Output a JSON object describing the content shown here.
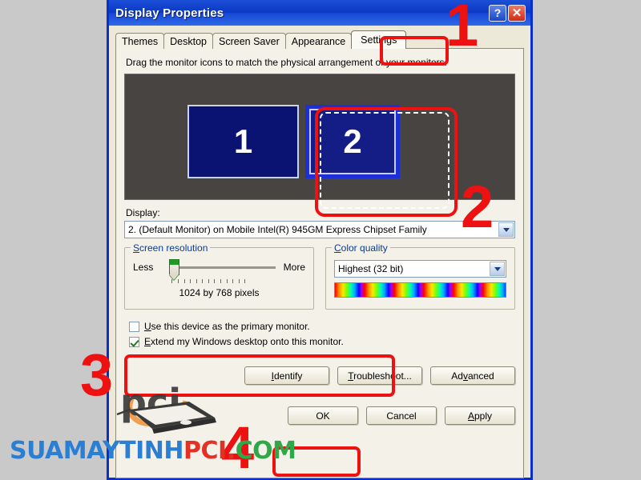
{
  "window": {
    "title": "Display Properties",
    "help_button": "?",
    "close_button": "✕"
  },
  "tabs": [
    {
      "label": "Themes",
      "active": false
    },
    {
      "label": "Desktop",
      "active": false
    },
    {
      "label": "Screen Saver",
      "active": false
    },
    {
      "label": "Appearance",
      "active": false
    },
    {
      "label": "Settings",
      "active": true
    }
  ],
  "settings": {
    "hint": "Drag the monitor icons to match the physical arrangement of your monitors.",
    "monitors": [
      {
        "number": "1",
        "selected": false
      },
      {
        "number": "2",
        "selected": true
      }
    ],
    "display_label": "Display:",
    "display_value": "2. (Default Monitor) on Mobile Intel(R) 945GM Express Chipset Family",
    "screen_resolution": {
      "legend": "Screen resolution",
      "less_label": "Less",
      "more_label": "More",
      "value_text": "1024 by 768 pixels",
      "slider_percent": 14
    },
    "color_quality": {
      "legend": "Color quality",
      "value": "Highest (32 bit)"
    },
    "checkboxes": [
      {
        "label": "Use this device as the primary monitor.",
        "checked": false,
        "accel": "U"
      },
      {
        "label": "Extend my Windows desktop onto this monitor.",
        "checked": true,
        "accel": "E"
      }
    ],
    "action_buttons": [
      {
        "label": "Identify",
        "accel": "I"
      },
      {
        "label": "Troubleshoot...",
        "accel": "T"
      },
      {
        "label": "Advanced",
        "accel": "v"
      }
    ],
    "dialog_buttons": [
      {
        "label": "OK",
        "highlighted": true
      },
      {
        "label": "Cancel",
        "highlighted": false
      },
      {
        "label": "Apply",
        "highlighted": false,
        "accel": "A"
      }
    ]
  },
  "annotations": [
    {
      "number": "1",
      "target": "settings-tab"
    },
    {
      "number": "2",
      "target": "monitor-2-icon"
    },
    {
      "number": "3",
      "target": "checkbox-group"
    },
    {
      "number": "4",
      "target": "ok-button"
    }
  ],
  "watermark": {
    "part1": "SUAMAYTINH",
    "part2": "PCI.",
    "part3": "COM",
    "logo_text": "pci",
    "colors": {
      "part1": "#2a7fd4",
      "part2": "#e23226",
      "part3": "#2fa84a"
    }
  }
}
